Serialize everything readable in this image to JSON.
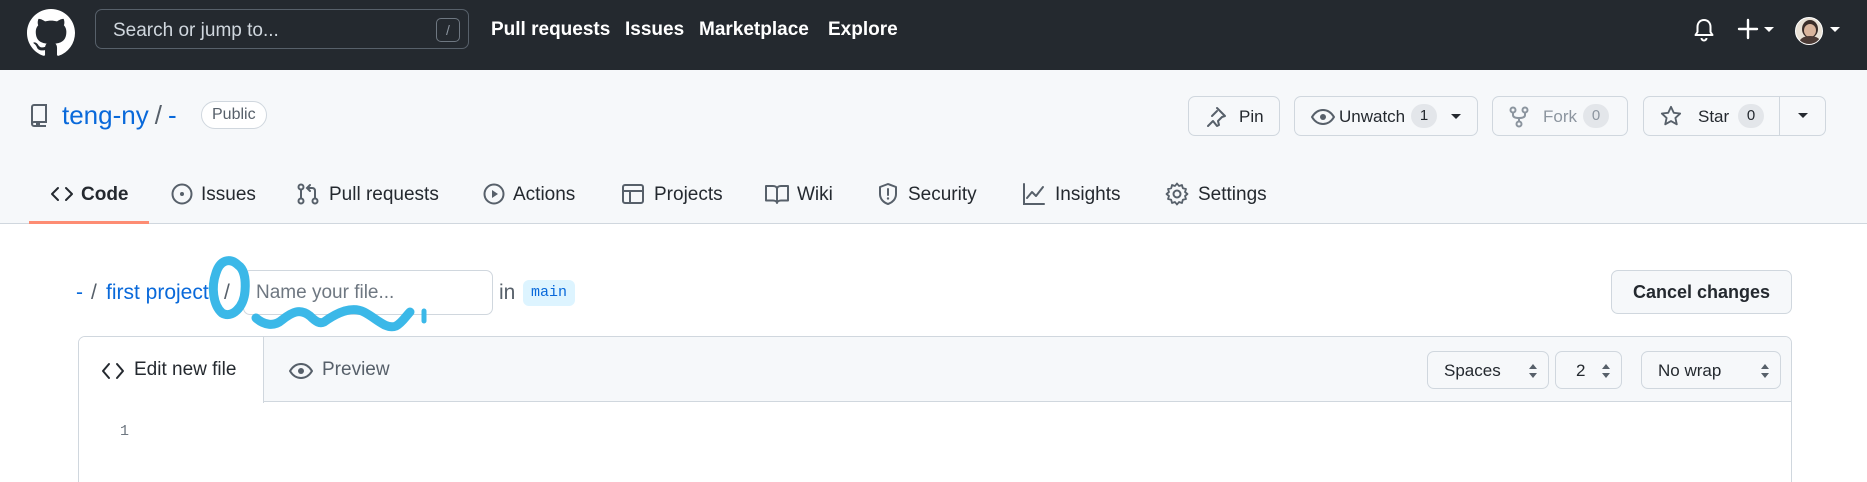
{
  "header": {
    "search_placeholder": "Search or jump to...",
    "search_shortcut": "/",
    "nav": [
      "Pull requests",
      "Issues",
      "Marketplace",
      "Explore"
    ]
  },
  "repo": {
    "owner": "teng-ny",
    "separator": "/",
    "name": "-",
    "visibility": "Public",
    "pin_label": "Pin",
    "unwatch_label": "Unwatch",
    "unwatch_count": "1",
    "fork_label": "Fork",
    "fork_count": "0",
    "star_label": "Star",
    "star_count": "0"
  },
  "tabs": [
    "Code",
    "Issues",
    "Pull requests",
    "Actions",
    "Projects",
    "Wiki",
    "Security",
    "Insights",
    "Settings"
  ],
  "breadcrumb": {
    "repo": "-",
    "sep": "/",
    "folder": "first project",
    "file_placeholder": "Name your file...",
    "in_label": "in",
    "branch": "main"
  },
  "cancel_label": "Cancel changes",
  "editor": {
    "edit_tab": "Edit new file",
    "preview_tab": "Preview",
    "indent_mode": "Spaces",
    "indent_size": "2",
    "wrap_mode": "No wrap",
    "line_numbers": [
      "1"
    ]
  },
  "colors": {
    "header_bg": "#24292f",
    "link": "#0969da",
    "tab_underline": "#fd8c73",
    "annotation": "#3bb8e8"
  }
}
